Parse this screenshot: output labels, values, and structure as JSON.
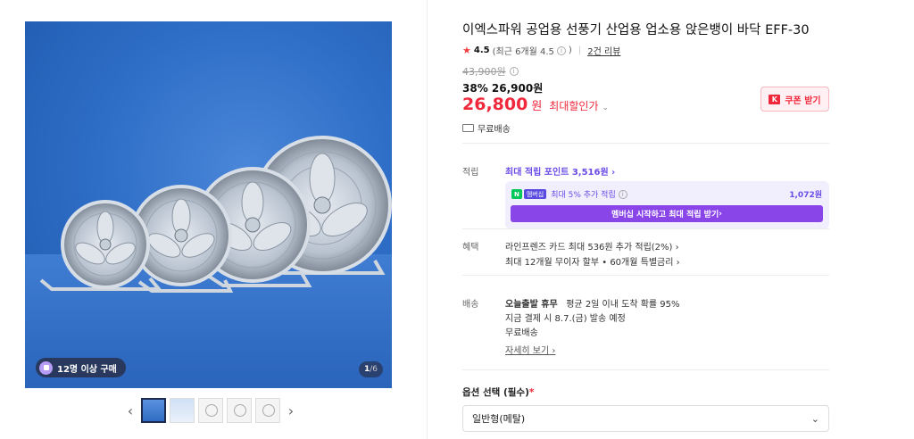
{
  "gallery": {
    "buy_badge": "12명 이상 구매",
    "page_current": "1",
    "page_total": "/6",
    "thumbnail_count": 5,
    "prev_icon": "chevron-left-icon",
    "next_icon": "chevron-right-icon"
  },
  "product": {
    "title": "이엑스파워 공업용 선풍기 산업용 업소용 앉은뱅이 바닥 EFF-30",
    "rating": "4.5",
    "rating_recent": "(최근 6개월 4.5",
    "rating_recent_close": ")",
    "reviews": "2건 리뷰",
    "original_price": "43,900원",
    "discount_line": "38% 26,900원",
    "final_price": "26,800",
    "final_won": "원",
    "max_discount_label": "최대할인가",
    "coupon_label": "쿠폰 받기",
    "coupon_icon_text": "K",
    "free_ship": "무료배송"
  },
  "points": {
    "label": "적립",
    "max_points": "최대 적립 포인트 3,516원",
    "n_badge": "N",
    "plus_badge": "멤버십",
    "extra": "최대 5% 추가 적립",
    "extra_amount": "1,072원",
    "membership_button": "멤버십 시작하고 최대 적립 받기"
  },
  "benefits": {
    "label": "혜택",
    "line1": "라인프렌즈 카드 최대 536원 추가 적립(2%)",
    "line2": "최대 12개월 무이자 할부 • 60개월 특별금리"
  },
  "delivery": {
    "label": "배송",
    "line1_bold": "오늘출발 휴무",
    "line1_rest": "평균 2일 이내 도착 확률 95%",
    "line2": "지금 결제 시 8.7.(금) 발송 예정",
    "line3": "무료배송",
    "detail_link": "자세히 보기"
  },
  "option": {
    "label": "옵션 선택 (필수)",
    "required_mark": "*",
    "selected": "일반형(메탈)"
  }
}
